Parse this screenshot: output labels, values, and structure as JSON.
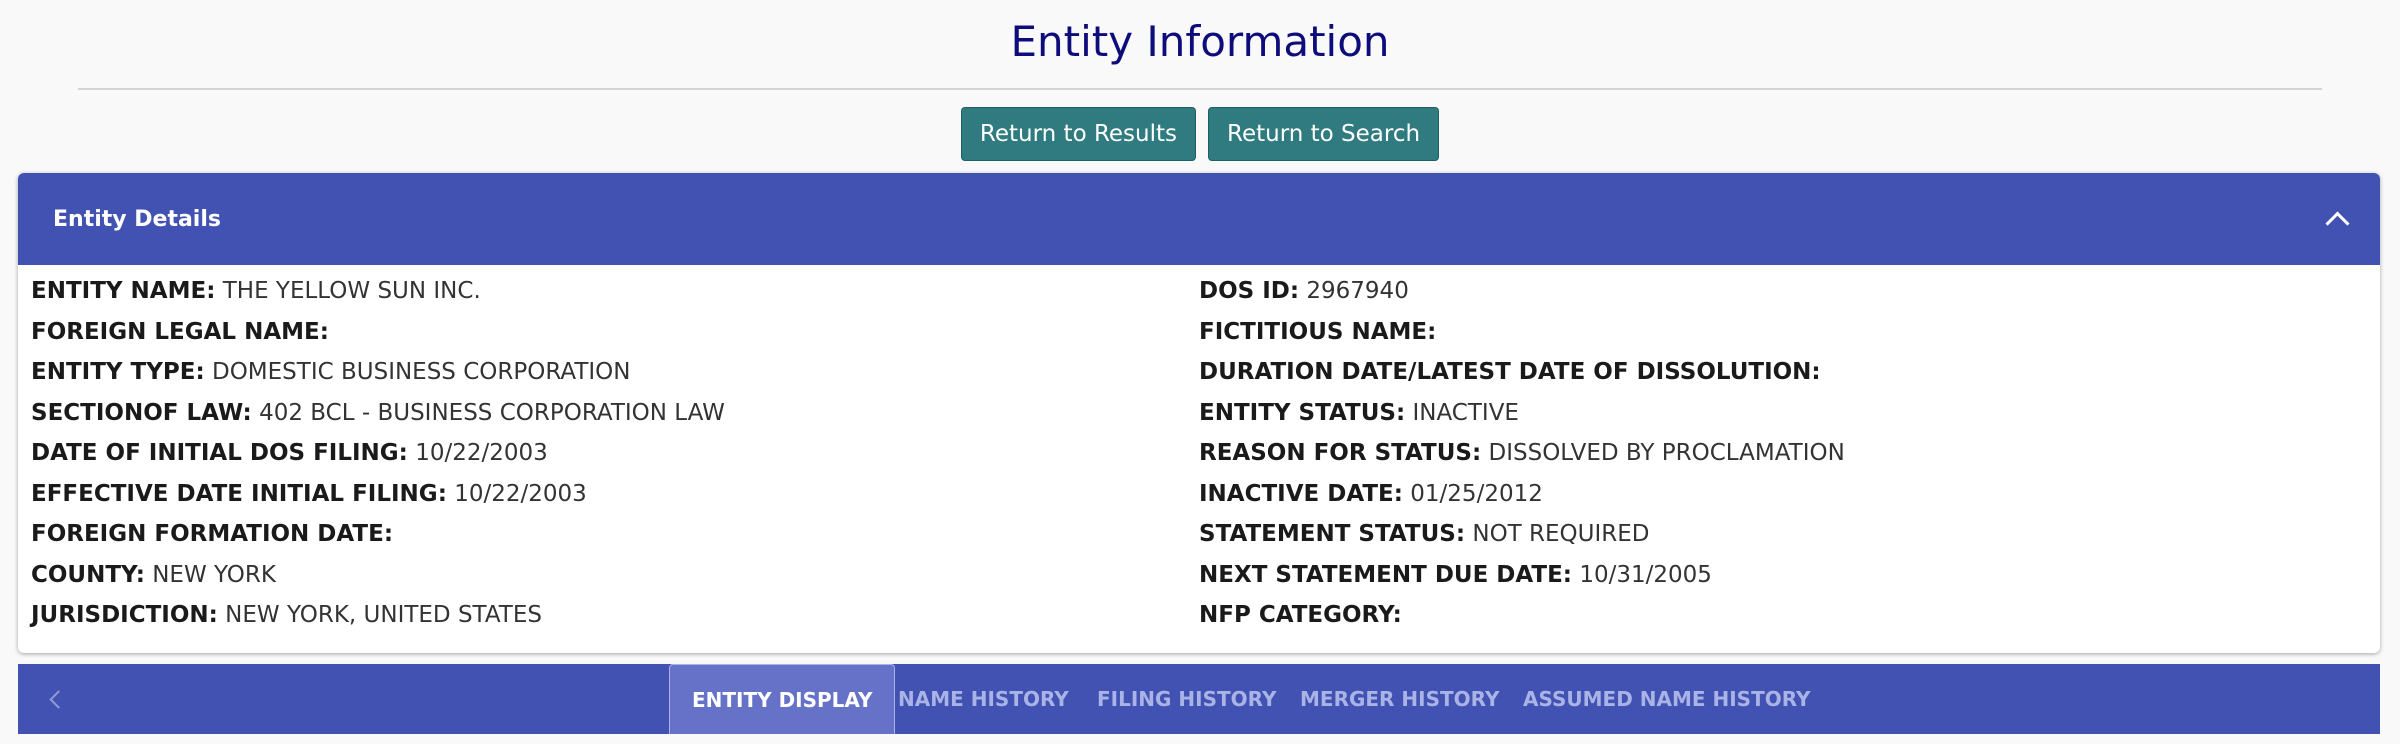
{
  "page": {
    "title": "Entity Information"
  },
  "actions": {
    "return_results": "Return to Results",
    "return_search": "Return to Search"
  },
  "details": {
    "header": "Entity Details",
    "left": [
      {
        "label": "ENTITY NAME:",
        "value": "THE YELLOW SUN INC."
      },
      {
        "label": "FOREIGN LEGAL NAME:",
        "value": ""
      },
      {
        "label": "ENTITY TYPE:",
        "value": "DOMESTIC BUSINESS CORPORATION"
      },
      {
        "label": "SECTIONOF LAW:",
        "value": "402 BCL - BUSINESS CORPORATION LAW"
      },
      {
        "label": "DATE OF INITIAL DOS FILING:",
        "value": "10/22/2003"
      },
      {
        "label": "EFFECTIVE DATE INITIAL FILING:",
        "value": "10/22/2003"
      },
      {
        "label": "FOREIGN FORMATION DATE:",
        "value": ""
      },
      {
        "label": "COUNTY:",
        "value": "NEW YORK"
      },
      {
        "label": "JURISDICTION:",
        "value": "NEW YORK, UNITED STATES"
      }
    ],
    "right": [
      {
        "label": "DOS ID:",
        "value": "2967940"
      },
      {
        "label": "FICTITIOUS NAME:",
        "value": ""
      },
      {
        "label": "DURATION DATE/LATEST DATE OF DISSOLUTION:",
        "value": ""
      },
      {
        "label": "ENTITY STATUS:",
        "value": "INACTIVE"
      },
      {
        "label": "REASON FOR STATUS:",
        "value": "DISSOLVED BY PROCLAMATION"
      },
      {
        "label": "INACTIVE DATE:",
        "value": "01/25/2012"
      },
      {
        "label": "STATEMENT STATUS:",
        "value": "NOT REQUIRED"
      },
      {
        "label": "NEXT STATEMENT DUE DATE:",
        "value": "10/31/2005"
      },
      {
        "label": "NFP CATEGORY:",
        "value": ""
      }
    ]
  },
  "tabs": [
    {
      "label": "ENTITY DISPLAY",
      "active": true
    },
    {
      "label": "NAME HISTORY",
      "active": false
    },
    {
      "label": "FILING HISTORY",
      "active": false
    },
    {
      "label": "MERGER HISTORY",
      "active": false
    },
    {
      "label": "ASSUMED NAME HISTORY",
      "active": false
    }
  ],
  "icons": {
    "collapse": "chevron-up-icon",
    "tabs_prev": "chevron-left-icon"
  },
  "colors": {
    "title": "#0d0c7a",
    "button": "#2f7b7f",
    "header": "#4252b3",
    "active_tab": "#6672c8"
  }
}
